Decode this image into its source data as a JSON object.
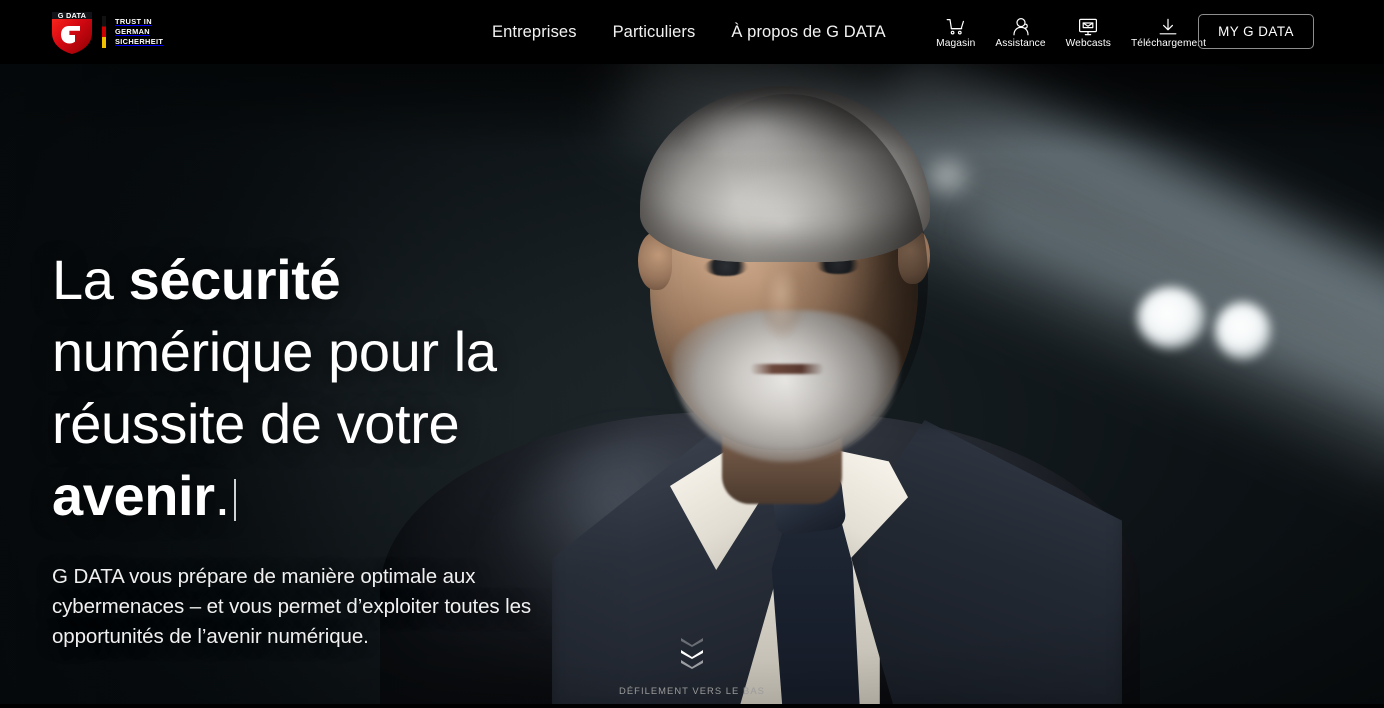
{
  "header": {
    "logo": {
      "brand": "G DATA",
      "claim_lines": [
        "TRUST IN",
        "GERMAN",
        "SICHERHEIT"
      ],
      "shield_color": "#d50000"
    },
    "nav": [
      {
        "label": "Entreprises"
      },
      {
        "label": "Particuliers"
      },
      {
        "label": "À propos de G DATA"
      }
    ],
    "utility": [
      {
        "label": "Magasin",
        "icon": "shopping-cart-icon"
      },
      {
        "label": "Assistance",
        "icon": "support-agent-icon"
      },
      {
        "label": "Webcasts",
        "icon": "monitor-webcast-icon"
      },
      {
        "label": "Téléchargement",
        "icon": "download-icon"
      }
    ],
    "account_button": "MY G DATA"
  },
  "hero": {
    "headline": {
      "part1": "La ",
      "bold1": "sécurité",
      "part2": " numérique pour la réussite de votre ",
      "bold2": "avenir",
      "part3": "."
    },
    "subcopy": "G DATA vous prépare de manière optimale aux cybermenaces – et vous permet d’exploiter toutes les opportunités de l’avenir numérique.",
    "scroll_label": "DÉFILEMENT VERS LE BAS",
    "background_colors": {
      "page": "#000000",
      "hero_dark": "#0d1316",
      "hero_mid": "#1a2226",
      "text": "#ffffff",
      "muted_text": "#9b9b9b"
    }
  }
}
